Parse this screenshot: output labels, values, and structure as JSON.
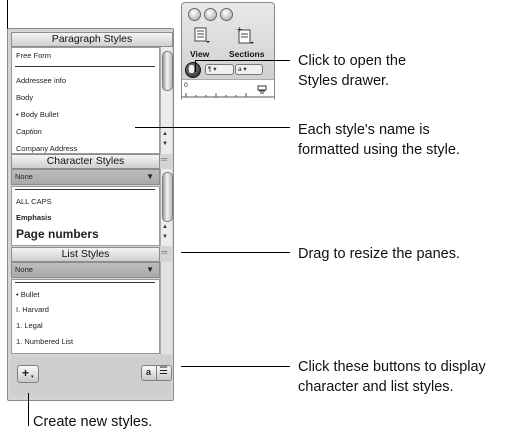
{
  "drawer": {
    "paragraph_header": "Paragraph Styles",
    "paragraph_items": [
      {
        "label": "Free Form",
        "style": "normal"
      },
      {
        "label": "Addressee info",
        "style": "normal"
      },
      {
        "label": "Body",
        "style": "normal"
      },
      {
        "label": "• Body Bullet",
        "style": "normal"
      },
      {
        "label": "Caption",
        "style": "italic"
      },
      {
        "label": "Company Address",
        "style": "normal"
      }
    ],
    "character_header": "Character Styles",
    "character_selected": "None",
    "character_items": [
      {
        "label": "ALL CAPS",
        "style": "normal"
      },
      {
        "label": "Emphasis",
        "style": "bold"
      },
      {
        "label": "Page numbers",
        "style": "large-bold"
      }
    ],
    "list_header": "List Styles",
    "list_selected": "None",
    "list_items": [
      {
        "label": "• Bullet"
      },
      {
        "label": "I. Harvard"
      },
      {
        "label": "1. Legal"
      },
      {
        "label": "1. Numbered List"
      }
    ],
    "add_button_label": "+",
    "char_toggle_label": "a"
  },
  "toolbar": {
    "view_label": "View",
    "sections_label": "Sections",
    "para_select": "¶ ▾",
    "char_select": "a ▾"
  },
  "callouts": {
    "open_drawer": "Click to open the Styles drawer.",
    "style_name": "Each style's name is formatted using the style.",
    "resize": "Drag to resize the panes.",
    "buttons": "Click these buttons to display character and list styles.",
    "create": "Create new styles."
  },
  "callout_lines": {
    "open_drawer": [
      "Click to open the",
      "Styles drawer."
    ],
    "style_name": [
      "Each style's name is",
      "formatted using the style."
    ],
    "buttons": [
      "Click these buttons to display",
      "character and list styles."
    ]
  }
}
